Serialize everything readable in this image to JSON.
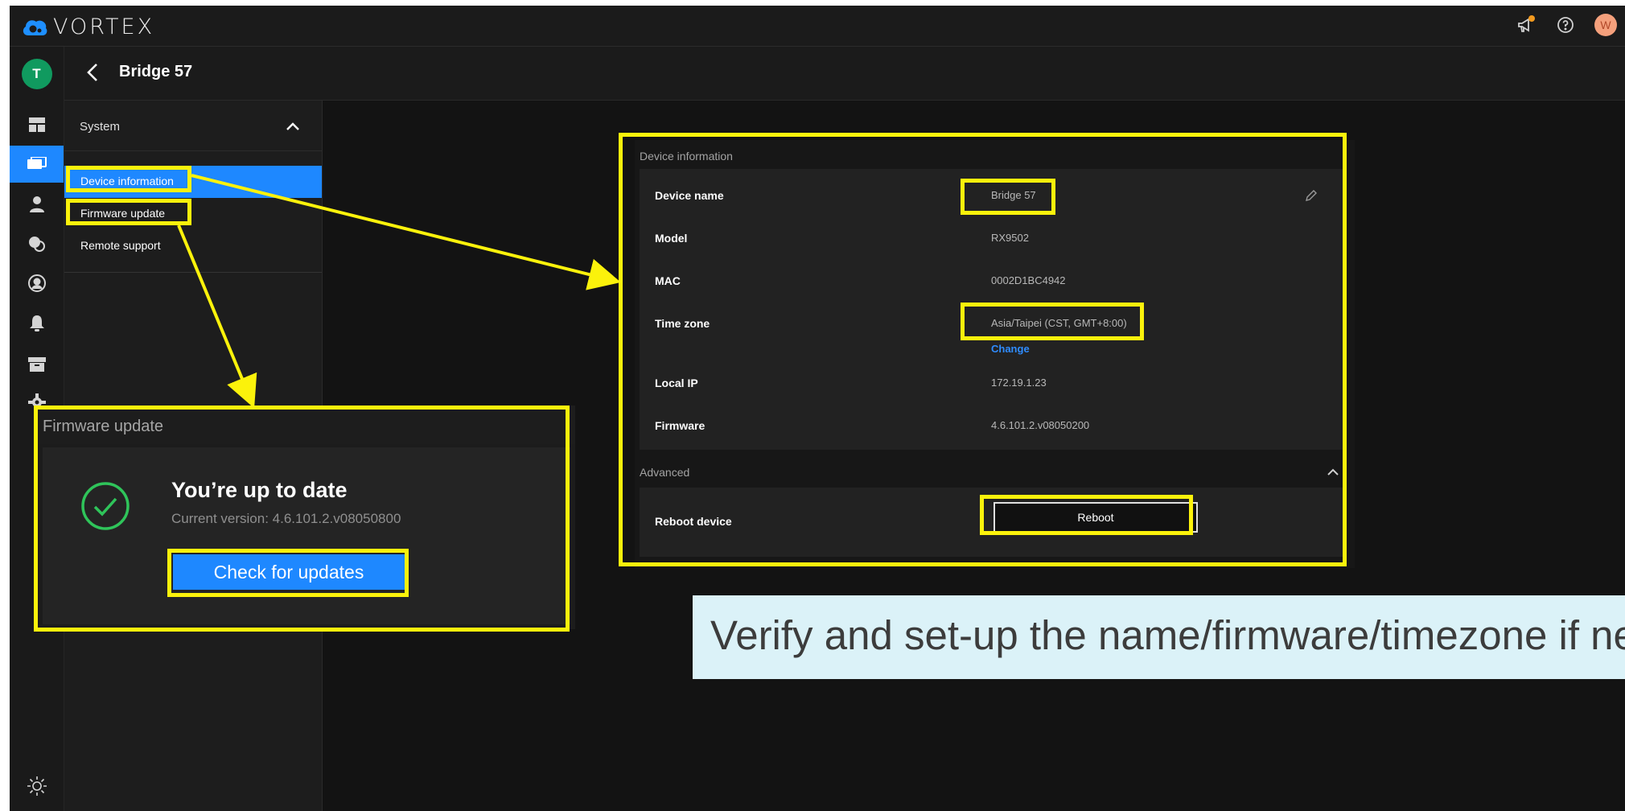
{
  "app": {
    "brand": "VORTEX",
    "accent": "#1e88ff",
    "highlight_color": "#fbf20b"
  },
  "topbar": {
    "icons": [
      "announcement-icon",
      "help-icon"
    ],
    "user_initial": "W"
  },
  "rail": {
    "user_initial": "T",
    "items": [
      "dashboard-icon",
      "devices-icon",
      "users-icon",
      "integrations-icon",
      "account-icon",
      "alerts-icon",
      "archive-icon",
      "settings-icon",
      "theme-icon"
    ]
  },
  "header": {
    "title": "Bridge 57"
  },
  "menu": {
    "section": "System",
    "items": [
      {
        "label": "Device information",
        "active": true
      },
      {
        "label": "Firmware update",
        "active": false
      },
      {
        "label": "Remote support",
        "active": false
      }
    ]
  },
  "device_info": {
    "section_title": "Device information",
    "rows": [
      {
        "label": "Device name",
        "value": "Bridge 57"
      },
      {
        "label": "Model",
        "value": "RX9502"
      },
      {
        "label": "MAC",
        "value": "0002D1BC4942"
      },
      {
        "label": "Time zone",
        "value": "Asia/Taipei (CST, GMT+8:00)",
        "link": "Change"
      },
      {
        "label": "Local IP",
        "value": "172.19.1.23"
      },
      {
        "label": "Firmware",
        "value": "4.6.101.2.v08050200"
      }
    ],
    "advanced": {
      "title": "Advanced",
      "reboot_label": "Reboot device",
      "reboot_button": "Reboot"
    }
  },
  "firmware_popup": {
    "title": "Firmware update",
    "heading": "You’re up to date",
    "version": "Current version: 4.6.101.2.v08050800",
    "button": "Check for updates"
  },
  "note": {
    "text": "Verify and set-up the name/firmware/timezone if needed"
  }
}
